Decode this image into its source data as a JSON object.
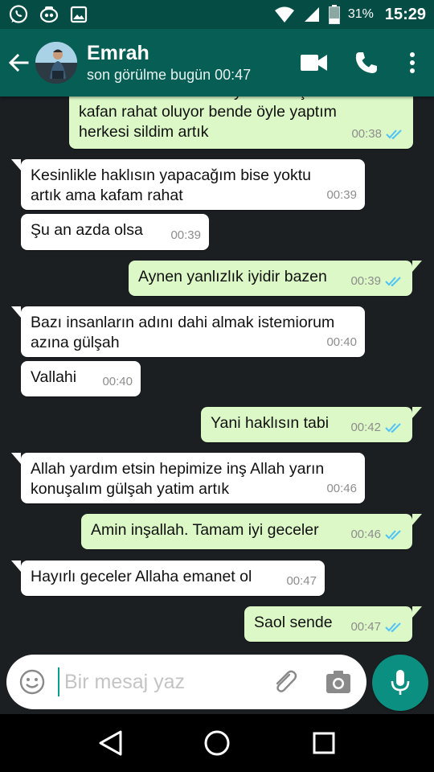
{
  "status_bar": {
    "battery_percent": "31%",
    "time": "15:29",
    "icons": [
      "whatsapp-icon",
      "alarm-icon",
      "gallery-icon",
      "wifi-icon",
      "signal-icon",
      "battery-icon"
    ]
  },
  "header": {
    "contact_name": "Emrah",
    "last_seen": "son görülme bugün 00:47",
    "icons": [
      "back-arrow-icon",
      "avatar",
      "video-call-icon",
      "phone-icon",
      "more-vert-icon"
    ]
  },
  "messages": [
    {
      "direction": "out",
      "text": "Seni üzen insanları hayatından çıkarınca\nkafan rahat oluyor bende öyle yaptım\nherkesi sildim artık",
      "time": "00:38",
      "read": true
    },
    {
      "direction": "in",
      "text": "Kesinlikle haklısın yapacağım bise yoktu\nartık ama kafam rahat",
      "time": "00:39"
    },
    {
      "direction": "in",
      "text": "Şu an azda olsa",
      "time": "00:39"
    },
    {
      "direction": "out",
      "text": "Aynen yanlızlık iyidir bazen",
      "time": "00:39",
      "read": true
    },
    {
      "direction": "in",
      "text": "Bazı insanların adını dahi almak istemiorum\nazına gülşah",
      "time": "00:40"
    },
    {
      "direction": "in",
      "text": "Vallahi",
      "time": "00:40"
    },
    {
      "direction": "out",
      "text": "Yani haklısın tabi",
      "time": "00:42",
      "read": true
    },
    {
      "direction": "in",
      "text": "Allah yardım etsin hepimize inş Allah yarın\nkonuşalım gülşah yatim artık",
      "time": "00:46"
    },
    {
      "direction": "out",
      "text": "Amin inşallah. Tamam iyi geceler",
      "time": "00:46",
      "read": true
    },
    {
      "direction": "in",
      "text": "Hayırlı geceler Allaha emanet ol",
      "time": "00:47"
    },
    {
      "direction": "out",
      "text": "Saol sende",
      "time": "00:47",
      "read": true
    }
  ],
  "composer": {
    "placeholder": "Bir mesaj yaz",
    "value": ""
  },
  "colors": {
    "header": "#075e54",
    "status_bar": "#054d44",
    "outgoing_bubble": "#dcf8c6",
    "incoming_bubble": "#ffffff",
    "read_tick": "#4fc3f7",
    "mic_button": "#0a8f80",
    "chat_background": "#1b1f22"
  },
  "nav": {
    "icons": [
      "nav-back-icon",
      "nav-home-icon",
      "nav-recents-icon"
    ]
  }
}
